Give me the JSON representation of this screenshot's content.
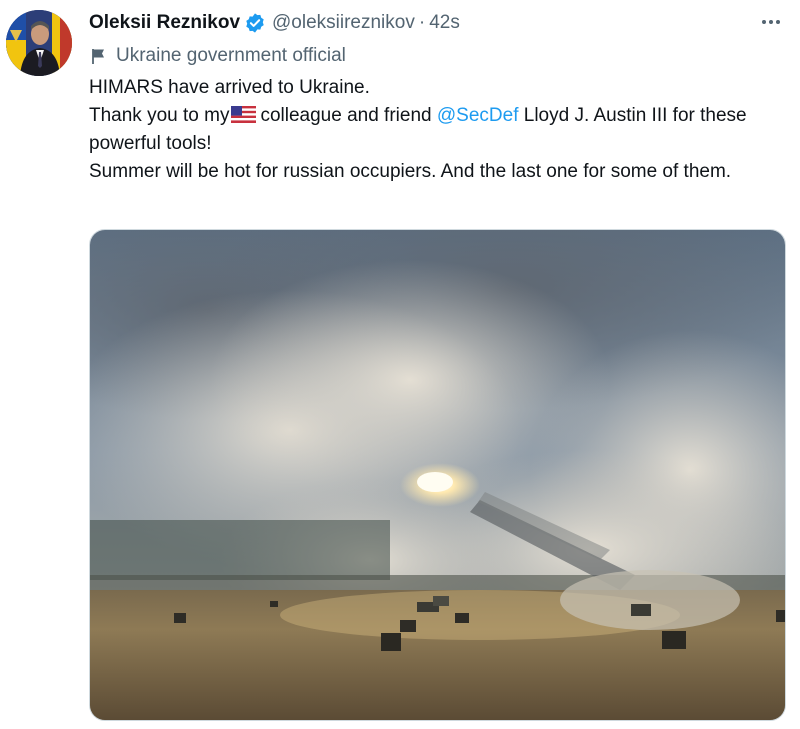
{
  "author": {
    "name": "Oleksii Reznikov",
    "handle": "@oleksiireznikov",
    "time": "42s",
    "label": "Ukraine government official"
  },
  "tweet": {
    "line1": "HIMARS have arrived to Ukraine.",
    "line2_before": "Thank you to my",
    "line2_after": "colleague and friend",
    "mention": "@SecDef",
    "line2_end": "Lloyd J. Austin III for these powerful tools!",
    "line3": "Summer will be hot for russian occupiers. And the last one for some of them."
  },
  "separators": {
    "dot": "·"
  },
  "icons": {
    "verified": "verified-badge-icon",
    "label": "flag-icon",
    "more": "more-options-icon",
    "emoji": "us-flag-emoji-icon"
  },
  "colors": {
    "link": "#1d9bf0",
    "secondary": "#536471",
    "text": "#0f1419"
  }
}
